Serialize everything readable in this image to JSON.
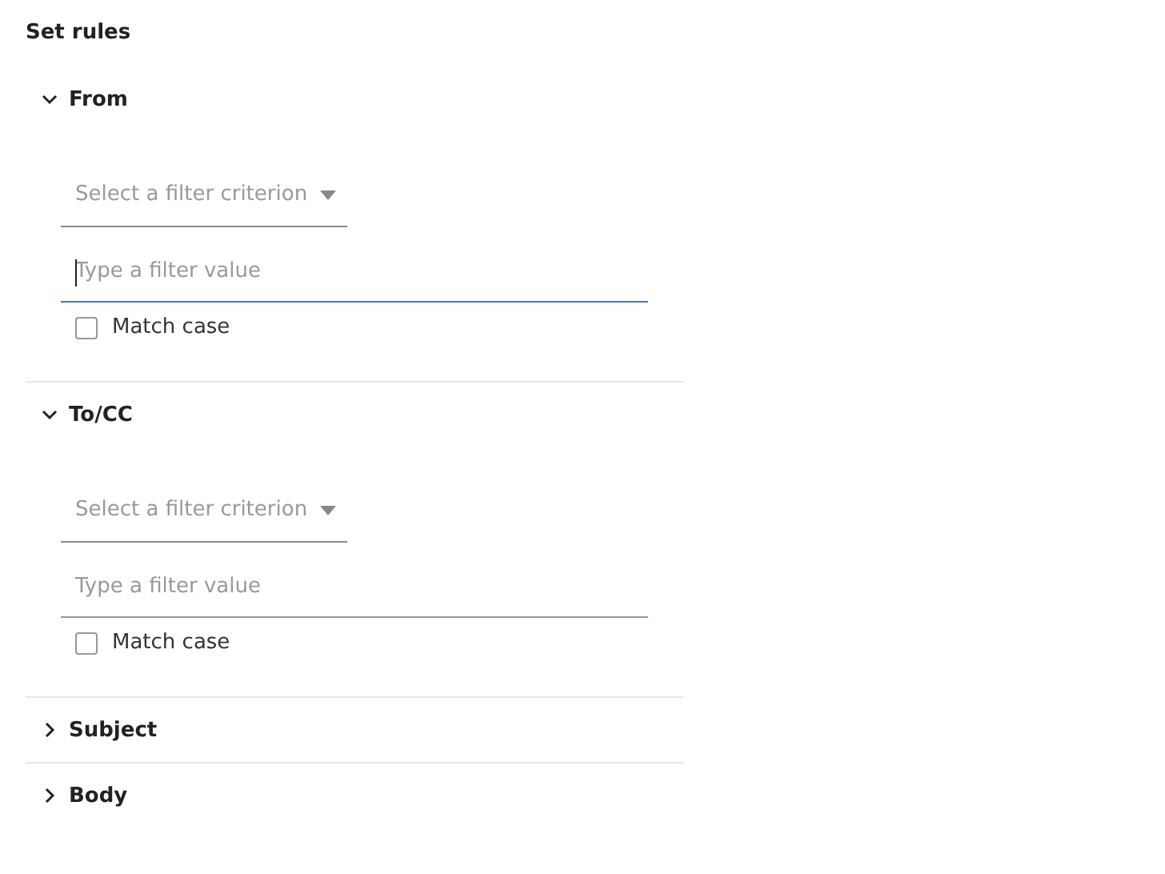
{
  "title": "Set rules",
  "sections": [
    {
      "label": "From",
      "expanded": true,
      "criterion": {
        "placeholder": "Select a filter criterion"
      },
      "value": {
        "placeholder": "Type a filter value",
        "focused": true
      },
      "match_case": {
        "label": "Match case",
        "checked": false
      }
    },
    {
      "label": "To/CC",
      "expanded": true,
      "criterion": {
        "placeholder": "Select a filter criterion"
      },
      "value": {
        "placeholder": "Type a filter value",
        "focused": false
      },
      "match_case": {
        "label": "Match case",
        "checked": false
      }
    },
    {
      "label": "Subject",
      "expanded": false
    },
    {
      "label": "Body",
      "expanded": false
    }
  ]
}
